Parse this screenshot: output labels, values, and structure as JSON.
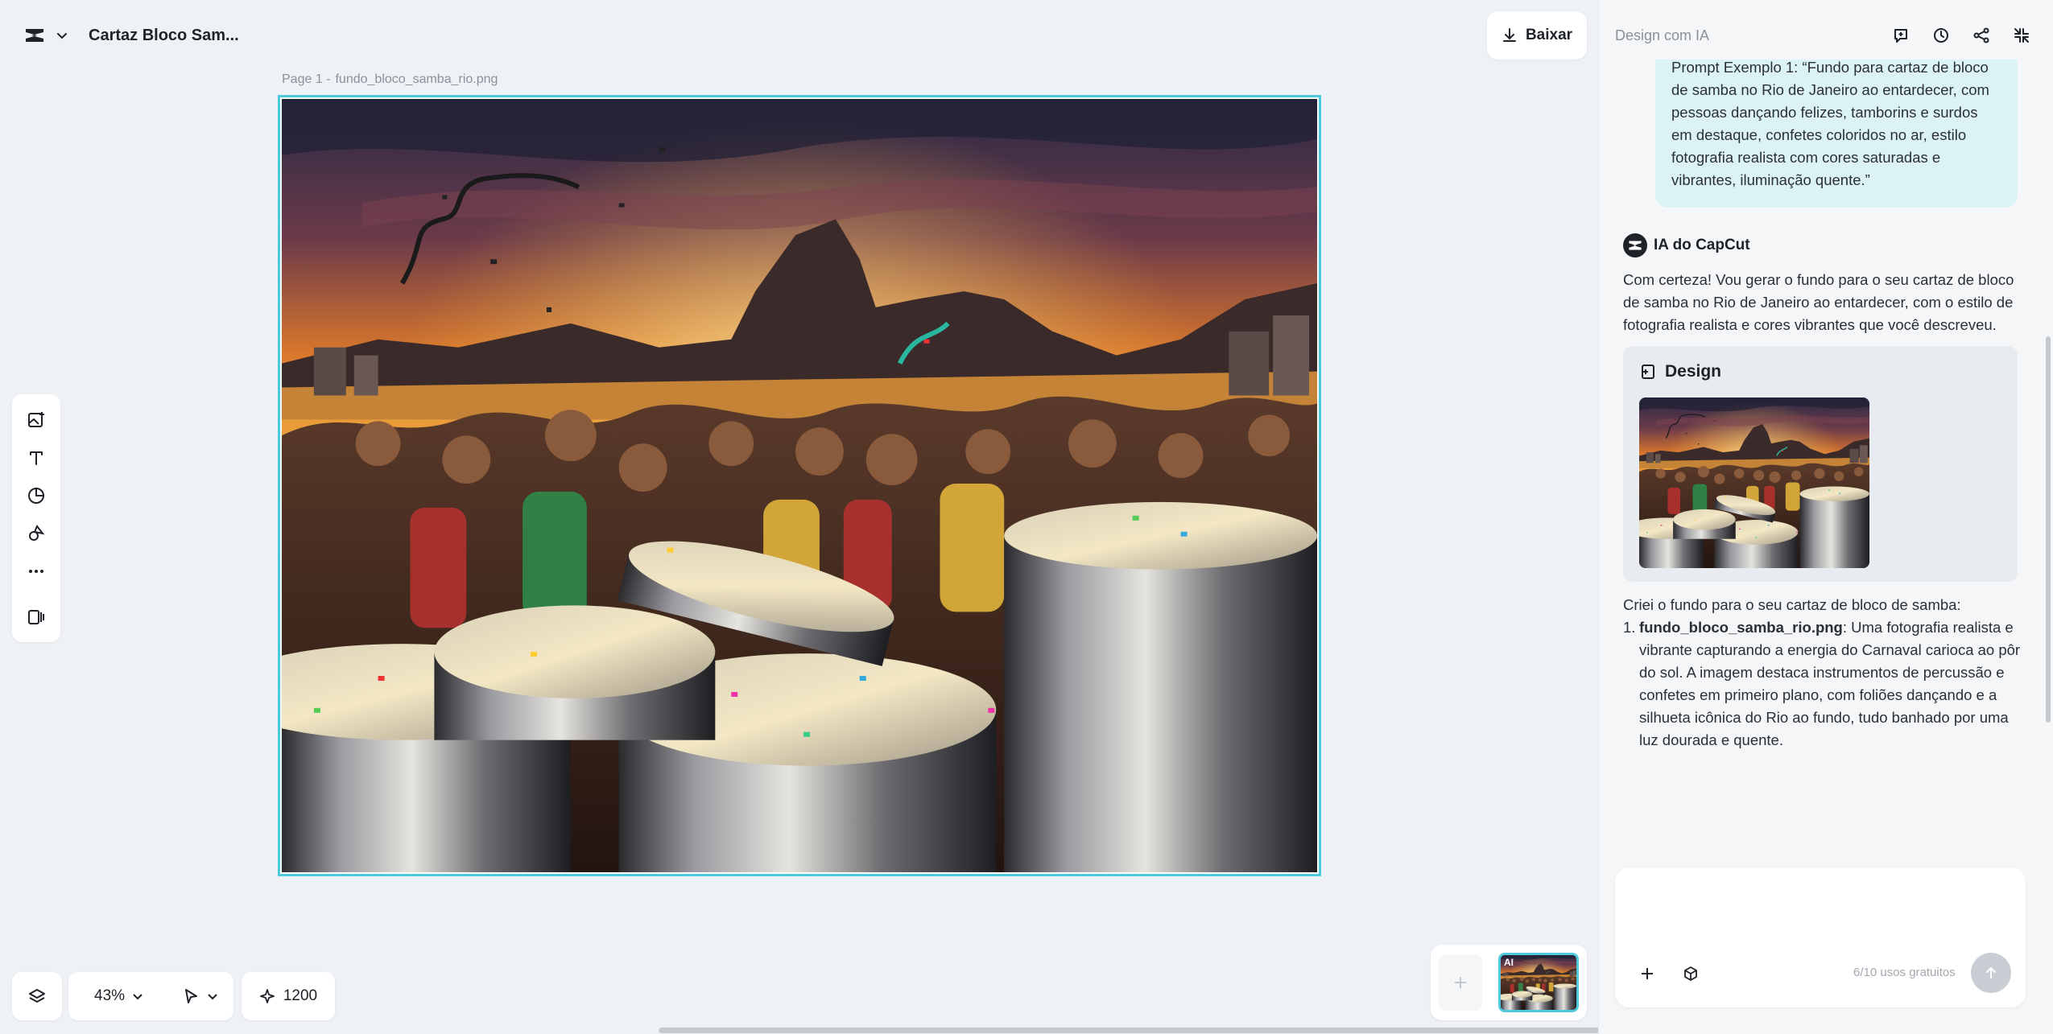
{
  "project": {
    "title": "Cartaz Bloco Sam...",
    "logo_icon": "capcut-logo-icon",
    "menu_icon": "chevron-down-icon"
  },
  "toolbar": {
    "download_label": "Baixar",
    "download_icon": "download-icon"
  },
  "canvas": {
    "page_label": "Page 1 -",
    "file_name": "fundo_bloco_samba_rio.png",
    "selection_color": "#4fc9dc"
  },
  "tools": [
    {
      "name": "add-image-tool",
      "icon": "image-plus-icon"
    },
    {
      "name": "text-tool",
      "icon": "text-icon"
    },
    {
      "name": "sticker-tool",
      "icon": "sticker-icon"
    },
    {
      "name": "shapes-tool",
      "icon": "shapes-icon"
    },
    {
      "name": "more-tool",
      "icon": "more-dots-icon"
    },
    {
      "name": "layout-tool",
      "icon": "panel-layout-icon"
    }
  ],
  "bottom": {
    "zoom": "43%",
    "credits": "1200",
    "layers_icon": "layers-icon",
    "pointer_icon": "pointer-icon",
    "credits_icon": "sparkle-icon"
  },
  "thumbnails": {
    "badge": "AI",
    "add_icon": "plus-icon"
  },
  "panel": {
    "title": "Design com IA",
    "header_icons": [
      "new-chat-icon",
      "history-icon",
      "share-icon",
      "collapse-icon"
    ],
    "user_message": "Prompt Exemplo 1: “Fundo para cartaz de bloco de samba no Rio de Janeiro ao entardecer, com pessoas dançando felizes, tamborins e surdos em destaque, confetes coloridos no ar, estilo fotografia realista com cores saturadas e vibrantes, iluminação quente.”",
    "ai_name": "IA do CapCut",
    "ai_message": "Com certeza! Vou gerar o fundo para o seu cartaz de bloco de samba no Rio de Janeiro ao entardecer, com o estilo de fotografia realista e cores vibrantes que você descreveu.",
    "design_card_title": "Design",
    "result_intro": "Criei o fundo para o seu cartaz de bloco de samba:",
    "result_items": [
      {
        "number": "1.",
        "file": "fundo_bloco_samba_rio.png",
        "description": ": Uma fotografia realista e vibrante capturando a energia do Carnaval carioca ao pôr do sol. A imagem destaca instrumentos de percussão e confetes em primeiro plano, com foliões dançando e a silhueta icônica do Rio ao fundo, tudo banhado por uma luz dourada e quente."
      }
    ],
    "input_placeholder": "",
    "usage": "6/10 usos gratuitos"
  }
}
